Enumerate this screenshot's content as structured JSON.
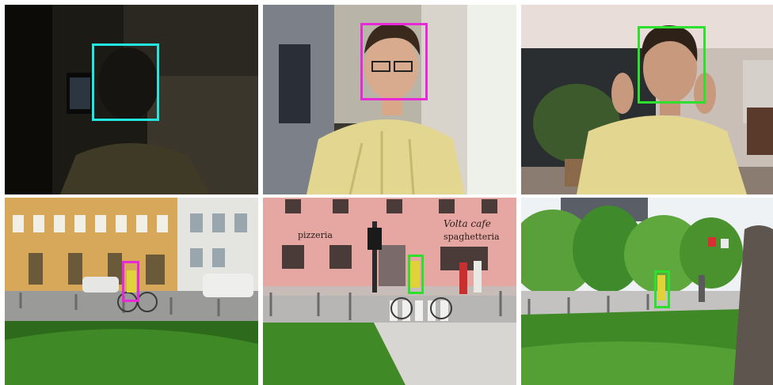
{
  "collage": {
    "panels": [
      {
        "scene": "dark-indoor-face",
        "box_color_name": "cyan",
        "box_color": "#22e6e0"
      },
      {
        "scene": "indoor-face-glasses",
        "box_color_name": "magenta",
        "box_color": "#e62ad8"
      },
      {
        "scene": "indoor-face-waving",
        "box_color_name": "green",
        "box_color": "#2de02d"
      },
      {
        "scene": "street-cyclist-yellow-buildings",
        "box_color_name": "magenta",
        "box_color": "#e62ad8"
      },
      {
        "scene": "street-cyclist-pink-building",
        "box_color_name": "green",
        "box_color": "#2de02d"
      },
      {
        "scene": "park-cyclist-trees",
        "box_color_name": "green",
        "box_color": "#2de02d"
      }
    ],
    "signs": {
      "pizzeria": "pizzeria",
      "spaghetteria": "spaghetteria",
      "cafe": "Volta cafe"
    }
  }
}
